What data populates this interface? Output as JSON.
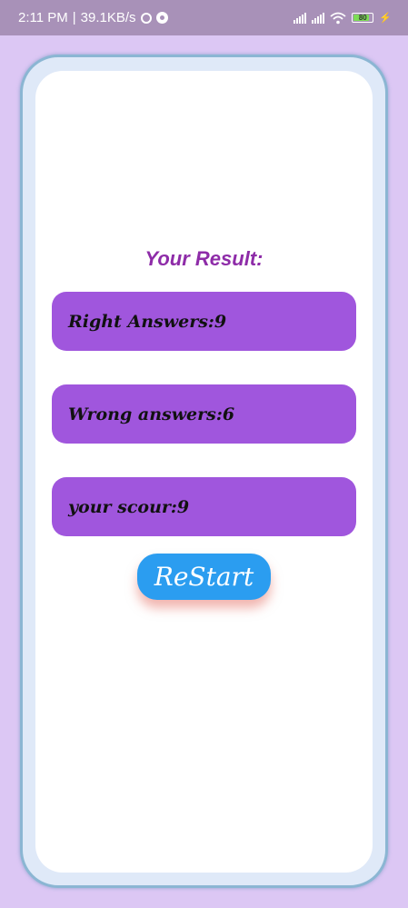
{
  "status_bar": {
    "time": "2:11 PM",
    "separator": "|",
    "speed": "39.1KB/s",
    "battery_level": "80",
    "icons": [
      "alarm-icon",
      "whatsapp-icon",
      "signal-icon",
      "signal-icon",
      "wifi-icon",
      "battery-icon",
      "charging-bolt-icon"
    ]
  },
  "result": {
    "title": "Your Result:",
    "right_answers": "Right Answers:9",
    "wrong_answers": "Wrong answers:6",
    "score": "your scour:9",
    "restart_label": "ReStart"
  },
  "colors": {
    "background": "#dcc7f4",
    "status_bar": "#a891b8",
    "title": "#8e2ca8",
    "result_box": "#a056dd",
    "restart_button": "#2b9df0",
    "frame_border": "#8bb6d3"
  }
}
